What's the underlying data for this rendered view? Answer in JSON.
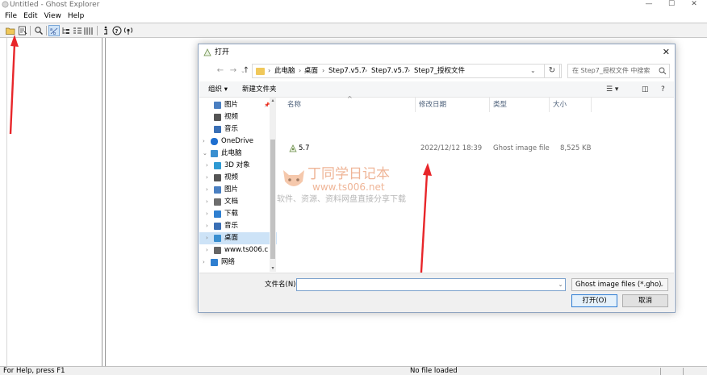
{
  "window": {
    "title": "Untitled - Ghost Explorer"
  },
  "menu": [
    "File",
    "Edit",
    "View",
    "Help"
  ],
  "toolbar": {
    "buttons": [
      "open-folder-icon",
      "properties-icon",
      "find-icon",
      "abc-view-icon",
      "tree-view-icon",
      "list-view-icon",
      "details-view-icon",
      "info-icon",
      "help-icon",
      "wireless-icon"
    ]
  },
  "status": {
    "help": "For Help, press F1",
    "file": "No file loaded"
  },
  "dialog": {
    "title": "打开",
    "close": "✕",
    "address": [
      "此电脑",
      "桌面",
      "Step7.v5.7",
      "Step7.v5.7",
      "Step7_授权文件"
    ],
    "search_placeholder": "在 Step7_授权文件 中搜索",
    "organize": "组织 ▾",
    "new_folder": "新建文件夹",
    "nav_items": [
      {
        "label": "图片",
        "icon": "pictures-icon",
        "pinned": true
      },
      {
        "label": "视频",
        "icon": "videos-icon"
      },
      {
        "label": "音乐",
        "icon": "music-icon"
      },
      {
        "label": "OneDrive",
        "icon": "onedrive-icon",
        "expandable": true
      },
      {
        "label": "此电脑",
        "icon": "this-pc-icon",
        "expanded": true
      },
      {
        "label": "3D 对象",
        "icon": "3d-objects-icon",
        "expandable": true
      },
      {
        "label": "视频",
        "icon": "videos-icon",
        "expandable": true
      },
      {
        "label": "图片",
        "icon": "pictures-icon",
        "expandable": true
      },
      {
        "label": "文档",
        "icon": "documents-icon",
        "expandable": true
      },
      {
        "label": "下载",
        "icon": "downloads-icon",
        "expandable": true
      },
      {
        "label": "音乐",
        "icon": "music-icon",
        "expandable": true
      },
      {
        "label": "桌面",
        "icon": "desktop-icon",
        "expandable": true,
        "selected": true
      },
      {
        "label": "www.ts006.c",
        "icon": "network-drive-icon",
        "expandable": true
      },
      {
        "label": "网络",
        "icon": "network-icon",
        "expandable": true
      }
    ],
    "columns": [
      "名称",
      "修改日期",
      "类型",
      "大小"
    ],
    "files": [
      {
        "name": "5.7",
        "modified": "2022/12/12 18:39",
        "type": "Ghost image file",
        "size": "8,525 KB"
      }
    ],
    "filename_label": "文件名(N):",
    "filename_value": "",
    "filetype": "Ghost image files (*.gho)",
    "open_button": "打开(O)",
    "cancel_button": "取消"
  },
  "watermark": {
    "title": "丁同学日记本",
    "url": "www.ts006.net",
    "subtitle": "软件、资源、资料网盘直接分享下载"
  },
  "colors": {
    "accent": "#2b7bd3",
    "selection": "#cde3f7",
    "arrow": "#e8262a",
    "folder": "#f0c85a"
  }
}
